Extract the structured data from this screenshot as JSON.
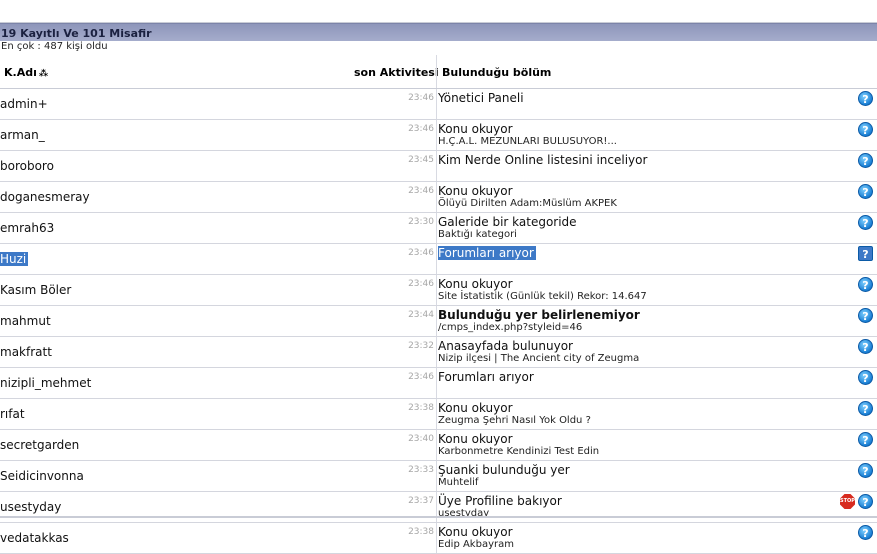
{
  "header": {
    "title": "19 Kayıtlı Ve 101 Misafir",
    "record": "En çok : 487 kişi oldu"
  },
  "columns": {
    "user": "K.Adı",
    "sort_glyph": "⁂",
    "activity": "son Aktivitesi",
    "location": "Bulunduğu bölüm"
  },
  "rows": [
    {
      "name": "admin+",
      "time": "23:46",
      "location": "Yönetici Paneli",
      "detail": ""
    },
    {
      "name": "arman_",
      "time": "23:46",
      "location": "Konu okuyor",
      "detail": "H.Ç.A.L. MEZUNLARI BULUSUYOR!..."
    },
    {
      "name": "boroboro",
      "time": "23:45",
      "location": "Kim Nerde Online listesini inceliyor",
      "detail": ""
    },
    {
      "name": "doganesmeray",
      "time": "23:46",
      "location": "Konu okuyor",
      "detail": "Ölüyü Dirilten Adam:Müslüm AKPEK"
    },
    {
      "name": "emrah63",
      "time": "23:30",
      "location": "Galeride bir kategoride",
      "detail": "Baktığı kategori"
    },
    {
      "name": "Huzi",
      "time": "23:46",
      "location": "Forumları arıyor",
      "detail": ""
    },
    {
      "name": "Kasım Böler",
      "time": "23:46",
      "location": "Konu okuyor",
      "detail": "Site İstatistik (Günlük tekil) Rekor: 14.647"
    },
    {
      "name": "mahmut",
      "time": "23:44",
      "location": "Bulunduğu yer belirlenemiyor",
      "detail": "/cmps_index.php?styleid=46"
    },
    {
      "name": "makfratt",
      "time": "23:32",
      "location": "Anasayfada bulunuyor",
      "detail": "Nizip ilçesi | The Ancient city of Zeugma"
    },
    {
      "name": "nizipli_mehmet",
      "time": "23:46",
      "location": "Forumları arıyor",
      "detail": ""
    },
    {
      "name": "rıfat",
      "time": "23:38",
      "location": "Konu okuyor",
      "detail": "Zeugma Şehri Nasıl Yok Oldu ?"
    },
    {
      "name": "secretgarden",
      "time": "23:40",
      "location": "Konu okuyor",
      "detail": "Karbonmetre Kendinizi Test Edin"
    },
    {
      "name": "Seidicinvonna",
      "time": "23:33",
      "location": "Şuanki bulunduğu yer",
      "detail": "Muhtelif"
    },
    {
      "name": "usestyday",
      "time": "23:37",
      "location": "Üye Profiline bakıyor",
      "detail": "usestyday"
    },
    {
      "name": "vedatakkas",
      "time": "23:38",
      "location": "Konu okuyor",
      "detail": "Edip Akbayram"
    }
  ],
  "icons": {
    "help": "?",
    "stop": "STOP"
  }
}
